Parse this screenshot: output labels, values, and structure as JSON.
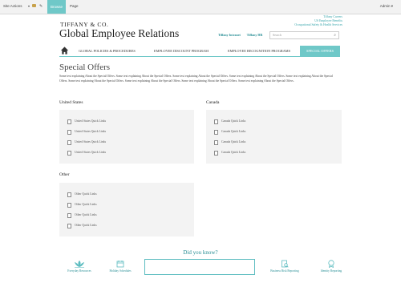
{
  "ribbon": {
    "site_actions": "Site Actions",
    "browse": "Browse",
    "page": "Page",
    "user": "Admin"
  },
  "header": {
    "logo": "TIFFANY & CO.",
    "title": "Global Employee Relations",
    "links": [
      "Tiffany Intranet",
      "Tiffany HR"
    ],
    "right_links": [
      "Tiffany Careers",
      "US Employee Benefits",
      "Occupational Safety & Health Services"
    ],
    "search_placeholder": "Search"
  },
  "nav": {
    "items": [
      "GLOBAL POLICIES & PROCEDURES",
      "EMPLOYEE DISCOUNT PROGRAM",
      "EMPLOYEE RECOGNITION PROGRAMS",
      "SPECIAL OFFERS"
    ],
    "active": "SPECIAL OFFERS"
  },
  "main": {
    "heading": "Special Offers",
    "intro": "Some text explaining About the Special Offers. Some text explaining About the Special Offers. Some text explaining About the Special Offers. Some text explaining About the Special Offers. Some text explaining About the Special Offers. Some text explaining About the Special Offers. Some text explaining About the Special Offers. Some text explaining About the Special Offers. Some text explaining About the Special Offers.",
    "sections": [
      {
        "title": "United States",
        "links": [
          "United States Quick Links",
          "United States Quick Links",
          "United States Quick Links",
          "United States Quick Links"
        ]
      },
      {
        "title": "Canada",
        "links": [
          "Canada Quick Links",
          "Canada Quick Links",
          "Canada Quick Links",
          "Canada Quick Links"
        ]
      },
      {
        "title": "Other",
        "links": [
          "Other Quick Links",
          "Other Quick Links",
          "Other Quick Links",
          "Other Quick Links"
        ]
      }
    ]
  },
  "footer": {
    "did_you_know": "Did you know?",
    "icons": [
      {
        "label": "Everyday Resources",
        "icon": "lotus-icon"
      },
      {
        "label": "Holiday Schedules",
        "icon": "calendar-icon"
      },
      {
        "label": "Business Risk Reporting",
        "icon": "document-magnifier-icon"
      },
      {
        "label": "Identity Reporting",
        "icon": "badge-icon"
      }
    ]
  },
  "colors": {
    "accent": "#6fc8c8",
    "link": "#2a8f96"
  }
}
